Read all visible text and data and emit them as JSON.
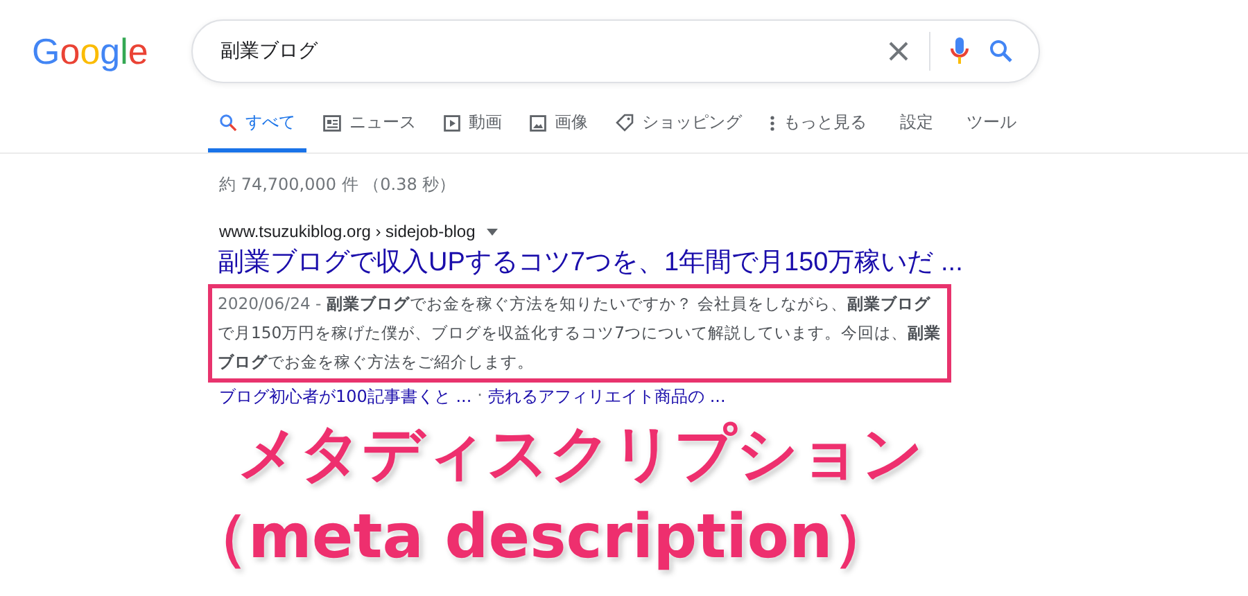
{
  "logo": "Google",
  "search": {
    "value": "副業ブログ"
  },
  "tabs": [
    {
      "label": "すべて",
      "kind": "search",
      "selected": true
    },
    {
      "label": "ニュース",
      "kind": "news",
      "selected": false
    },
    {
      "label": "動画",
      "kind": "video",
      "selected": false
    },
    {
      "label": "画像",
      "kind": "image",
      "selected": false
    },
    {
      "label": "ショッピング",
      "kind": "shopping",
      "selected": false
    },
    {
      "label": "もっと見る",
      "kind": "more",
      "selected": false
    }
  ],
  "tools": [
    "設定",
    "ツール"
  ],
  "result_stats": "約 74,700,000 件 （0.38 秒）",
  "result": {
    "url": "www.tsuzukiblog.org › sidejob-blog",
    "title": "副業ブログで収入UPするコツ7つを、1年間で月150万稼いだ ...",
    "date": "2020/06/24 - ",
    "description": "**副業ブログ**でお金を稼ぐ方法を知りたいですか？ 会社員をしながら、**副業ブログ**で月150万円を稼げた僕が、ブログを収益化するコツ7つについて解説しています。今回は、**副業ブログ**でお金を稼ぐ方法をご紹介します。",
    "sitelinks": [
      "ブログ初心者が100記事書くと ...",
      "売れるアフィリエイト商品の ..."
    ],
    "sitelink_separator": "·"
  },
  "annotation": [
    "メタディスクリプション",
    "（meta description）"
  ]
}
